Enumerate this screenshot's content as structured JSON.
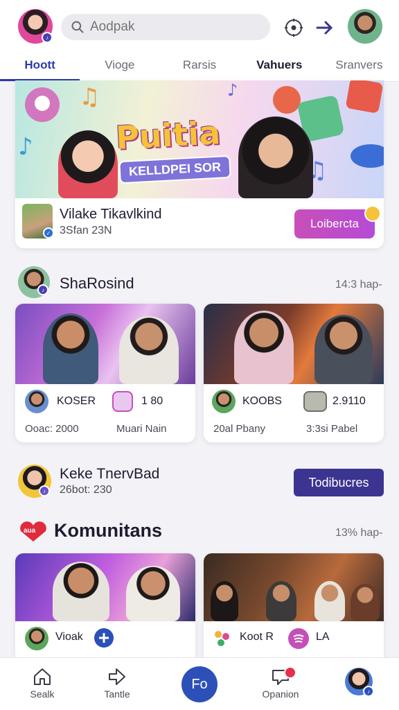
{
  "header": {
    "search_placeholder": "Aodpak",
    "tabs": [
      {
        "label": "Hoott",
        "active": true
      },
      {
        "label": "Viogе"
      },
      {
        "label": "Rarsis"
      },
      {
        "label": "Vahuers"
      },
      {
        "label": "Sranvers"
      }
    ]
  },
  "hero": {
    "title": "Puitia",
    "subtitle": "KELLDPEI SOR",
    "creator_name": "Vilake Tikavlkind",
    "creator_meta": "3Sfan 23N",
    "button_label": "Loibercta"
  },
  "section1": {
    "title": "ShaRosind",
    "time": "14:3 hap-",
    "cards": [
      {
        "name": "KOSER",
        "stat": "1 80",
        "sub_left": "Ooac: 2000",
        "sub_right": "Muari Nain"
      },
      {
        "name": "KOOBS",
        "stat": "2.9110",
        "sub_left": "20al Pbany",
        "sub_right": "3:3si Pabel"
      }
    ]
  },
  "creator2": {
    "name": "Keke TnervBad",
    "meta": "26bot: 230",
    "button_label": "Todibucres"
  },
  "section2": {
    "logo_text": "aua",
    "title": "Komunitans",
    "time": "13% hap-",
    "cards": [
      {
        "name": "Vioak"
      },
      {
        "name": "Koot R",
        "extra": "LA"
      }
    ]
  },
  "bottom_nav": {
    "items": [
      {
        "label": "Sealk"
      },
      {
        "label": "Tantle"
      },
      {
        "label": "Fo"
      },
      {
        "label": "Opanion"
      }
    ]
  },
  "colors": {
    "accent": "#2e3aa8",
    "join_button": "#c84fb9",
    "subscribe_button": "#3b3490",
    "fab": "#2d50b8",
    "notification": "#e8304a"
  }
}
